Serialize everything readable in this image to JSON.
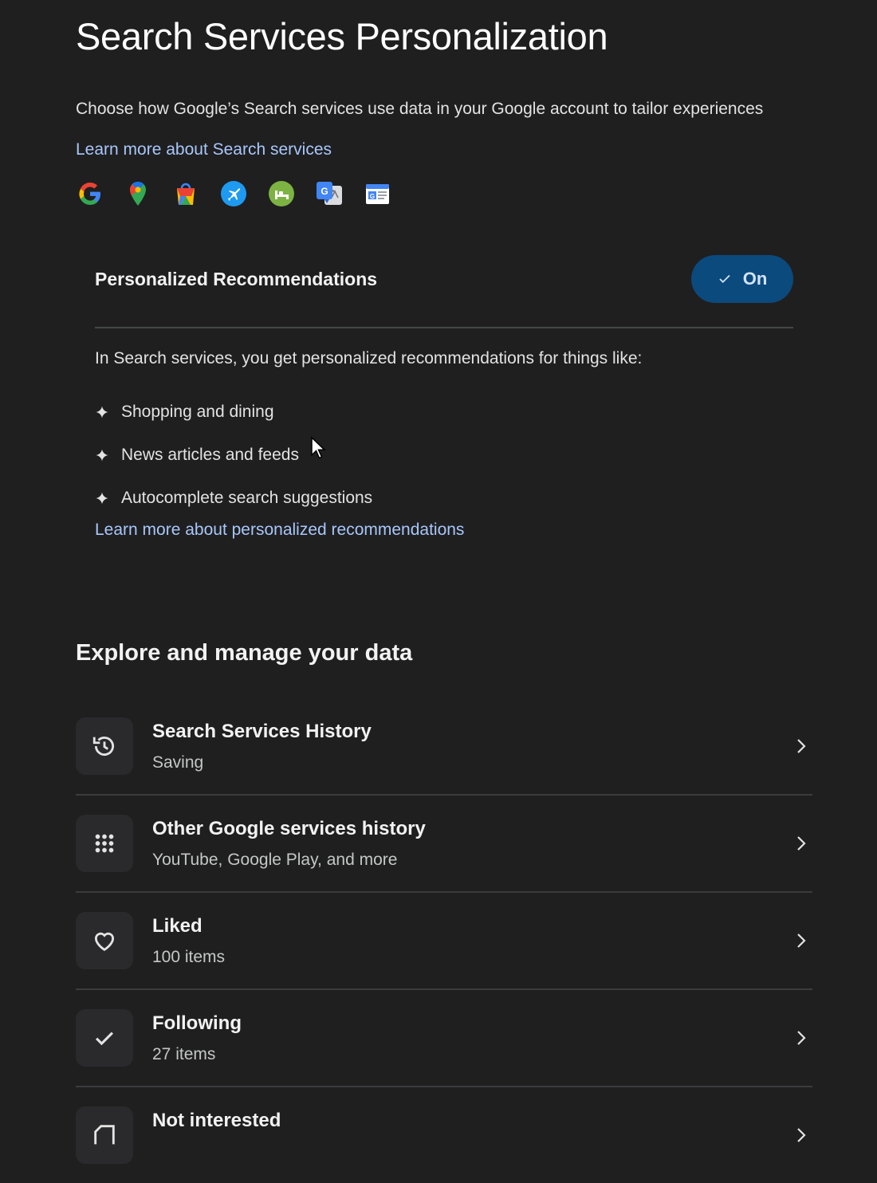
{
  "header": {
    "title": "Search Services Personalization",
    "intro": "Choose how Google’s Search services use data in your Google account to tailor experiences",
    "learn_more": "Learn more about Search services"
  },
  "services": [
    "google-g-icon",
    "maps-pin-icon",
    "shopping-bag-icon",
    "flights-icon",
    "hotels-icon",
    "translate-icon",
    "news-icon"
  ],
  "card": {
    "title": "Personalized Recommendations",
    "toggle_label": "On",
    "toggle_state": "on",
    "description": "In Search services, you get personalized recommendations for things like:",
    "bullets": [
      "Shopping and dining",
      "News articles and feeds",
      "Autocomplete search suggestions"
    ],
    "link": "Learn more about personalized recommendations"
  },
  "section": {
    "title": "Explore and manage your data",
    "rows": [
      {
        "title": "Search Services History",
        "subtitle": "Saving",
        "icon": "history-icon"
      },
      {
        "title": "Other Google services history",
        "subtitle": "YouTube, Google Play, and more",
        "icon": "apps-grid-icon"
      },
      {
        "title": "Liked",
        "subtitle": "100 items",
        "icon": "heart-icon"
      },
      {
        "title": "Following",
        "subtitle": "27 items",
        "icon": "check-icon"
      },
      {
        "title": "Not interested",
        "subtitle": "",
        "icon": "not-interested-icon"
      }
    ]
  },
  "colors": {
    "background": "#1f1f20",
    "link": "#a8c7fa",
    "toggle_bg": "#0b4a7d",
    "toggle_text": "#d3e3fd"
  }
}
